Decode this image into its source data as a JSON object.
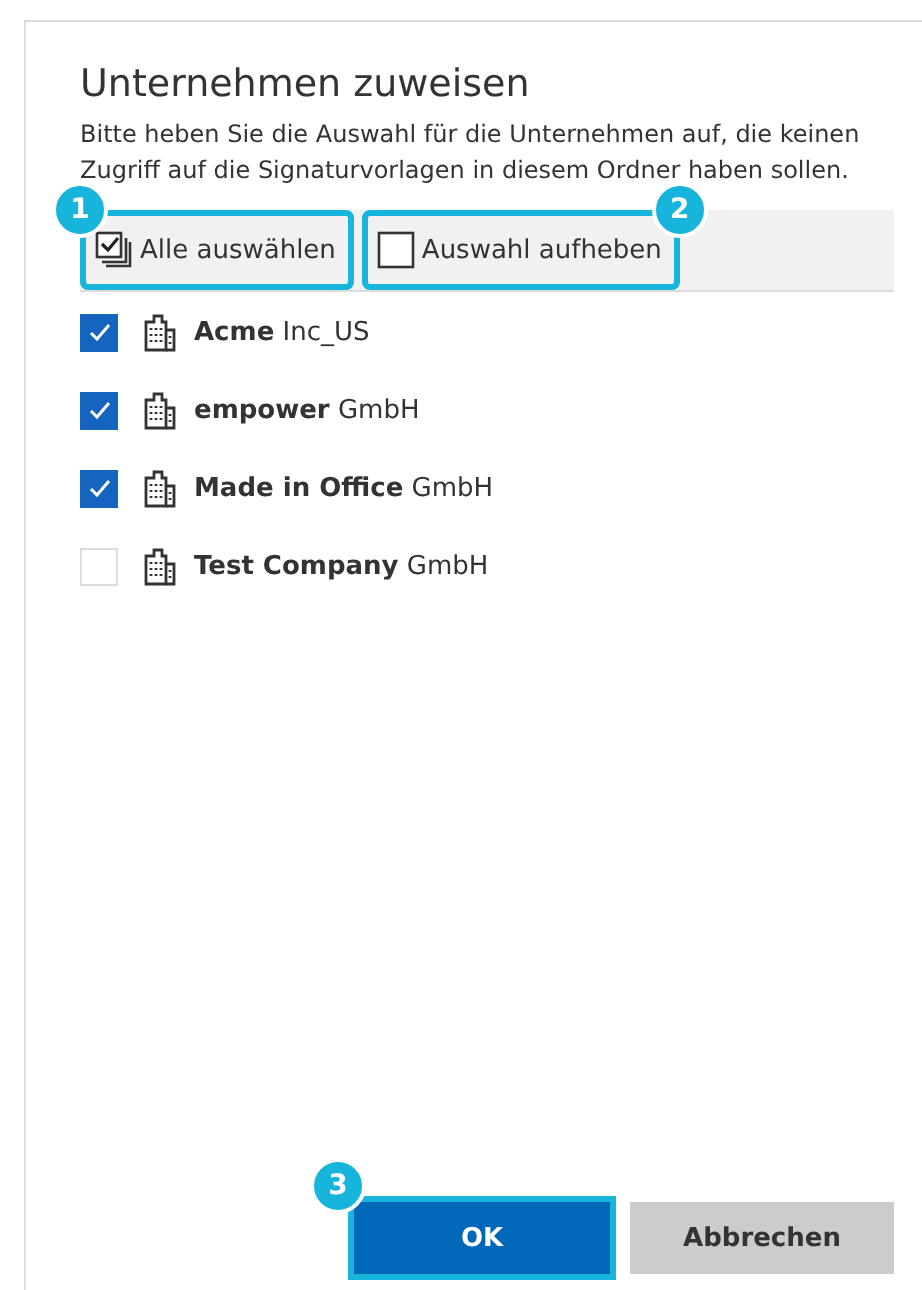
{
  "dialog": {
    "title": "Unternehmen zuweisen",
    "description": "Bitte heben Sie die Auswahl für die Unternehmen auf, die keinen Zugriff auf die Signaturvorlagen in diesem Ordner haben sollen."
  },
  "toolbar": [
    {
      "kind": "select_all",
      "label": "Alle auswählen",
      "callout": "1"
    },
    {
      "kind": "deselect_all",
      "label": "Auswahl aufheben",
      "callout": "2"
    }
  ],
  "companies": [
    {
      "name": "**Acme** Inc_US",
      "checked": true
    },
    {
      "name": "**empower** GmbH",
      "checked": true
    },
    {
      "name": "**Made in Office** GmbH",
      "checked": true
    },
    {
      "name": "**Test Company** GmbH",
      "checked": false
    }
  ],
  "buttons": [
    {
      "label": "OK",
      "primary": true,
      "callout": "3"
    },
    {
      "label": "Abbrechen",
      "primary": false
    }
  ]
}
